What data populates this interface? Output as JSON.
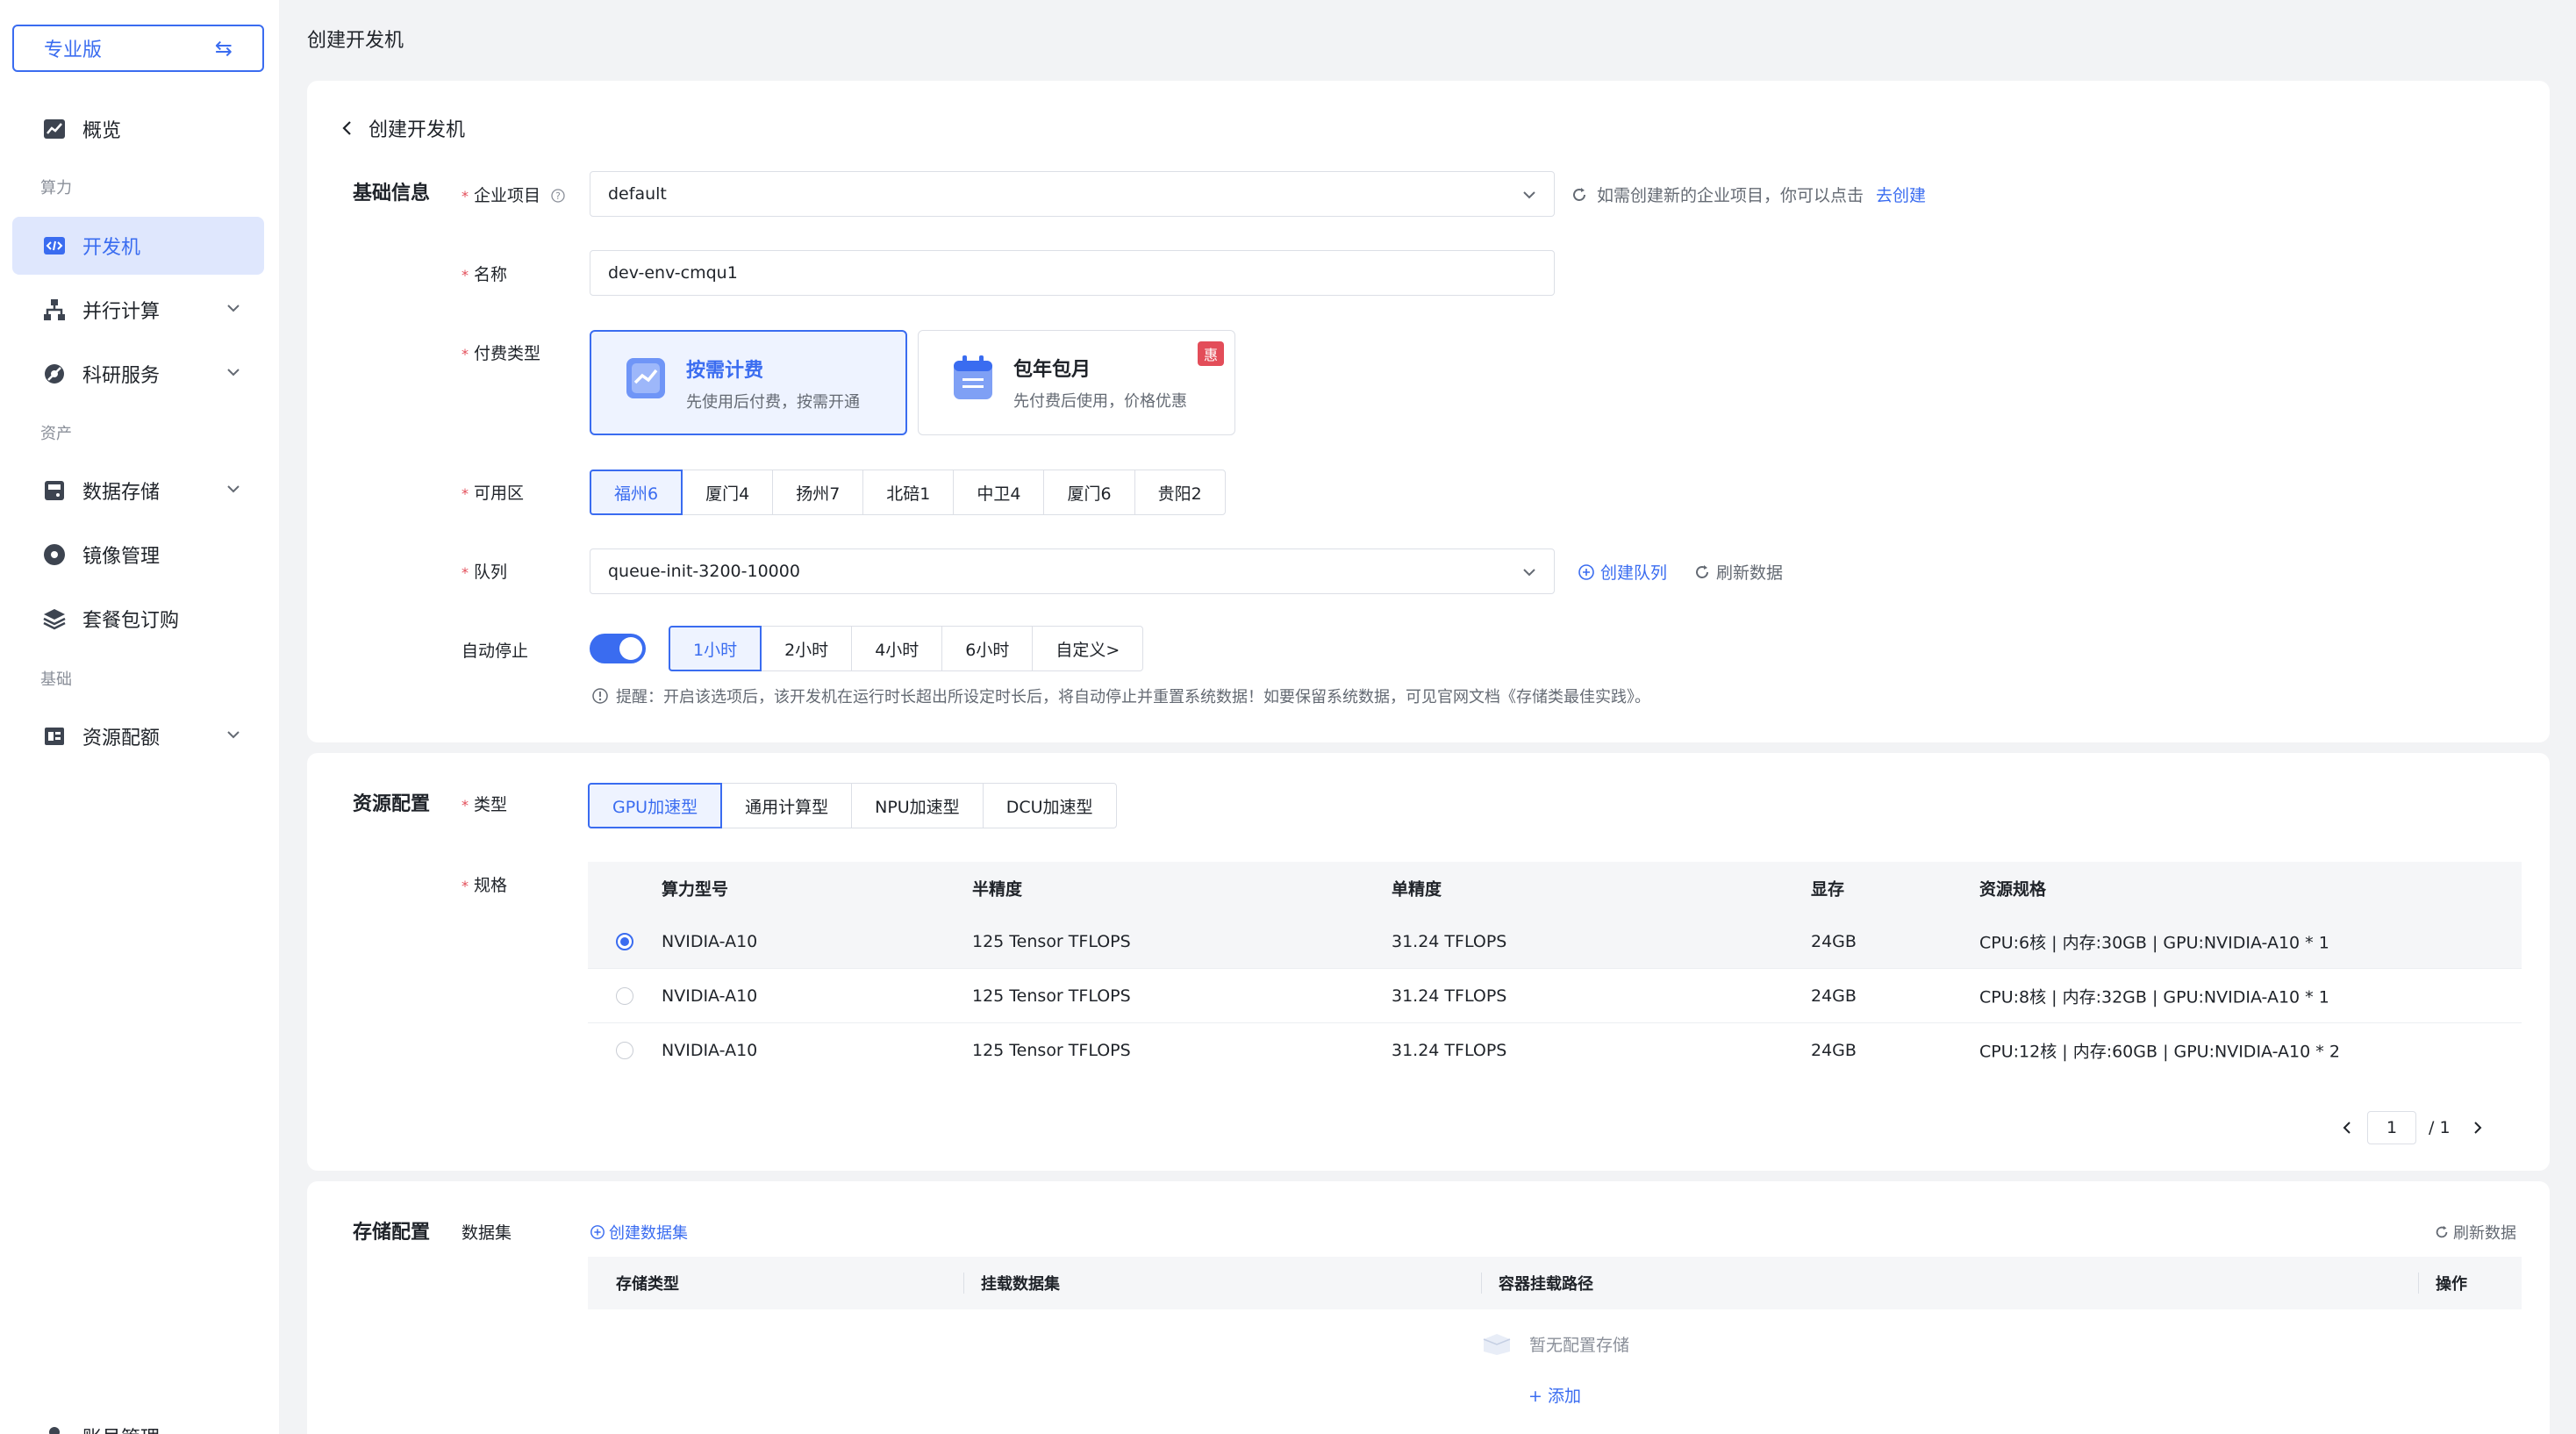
{
  "sidebar": {
    "edition_label": "专业版",
    "items": {
      "overview": "概览",
      "dev_machine": "开发机",
      "parallel": "并行计算",
      "research": "科研服务",
      "storage": "数据存储",
      "image": "镜像管理",
      "package": "套餐包订购",
      "quota": "资源配额",
      "account": "账号管理"
    },
    "groups": {
      "compute": "算力",
      "assets": "资产",
      "basic": "基础"
    }
  },
  "page": {
    "top_title": "创建开发机",
    "back_title": "创建开发机"
  },
  "basic": {
    "section_title": "基础信息",
    "project_label": "企业项目",
    "project_value": "default",
    "project_hint": "如需创建新的企业项目，你可以点击",
    "project_link": "去创建",
    "name_label": "名称",
    "name_value": "dev-env-cmqu1",
    "pay_label": "付费类型",
    "pay_options": [
      {
        "title": "按需计费",
        "sub": "先使用后付费，按需开通"
      },
      {
        "title": "包年包月",
        "sub": "先付费后使用，价格优惠",
        "badge": "惠"
      }
    ],
    "zone_label": "可用区",
    "zones": [
      "福州6",
      "厦门4",
      "扬州7",
      "北碚1",
      "中卫4",
      "厦门6",
      "贵阳2"
    ],
    "queue_label": "队列",
    "queue_value": "queue-init-3200-10000",
    "create_queue": "创建队列",
    "refresh": "刷新数据",
    "autostop_label": "自动停止",
    "autostop_options": [
      "1小时",
      "2小时",
      "4小时",
      "6小时",
      "自定义>"
    ],
    "autostop_tip": "提醒：开启该选项后，该开发机在运行时长超出所设定时长后，将自动停止并重置系统数据！如要保留系统数据，可见官网文档《存储类最佳实践》。"
  },
  "resource": {
    "section_title": "资源配置",
    "type_label": "类型",
    "types": [
      "GPU加速型",
      "通用计算型",
      "NPU加速型",
      "DCU加速型"
    ],
    "spec_label": "规格",
    "columns": [
      "算力型号",
      "半精度",
      "单精度",
      "显存",
      "资源规格"
    ],
    "rows": [
      [
        "NVIDIA-A10",
        "125 Tensor TFLOPS",
        "31.24 TFLOPS",
        "24GB",
        "CPU:6核 | 内存:30GB | GPU:NVIDIA-A10 * 1"
      ],
      [
        "NVIDIA-A10",
        "125 Tensor TFLOPS",
        "31.24 TFLOPS",
        "24GB",
        "CPU:8核 | 内存:32GB | GPU:NVIDIA-A10 * 1"
      ],
      [
        "NVIDIA-A10",
        "125 Tensor TFLOPS",
        "31.24 TFLOPS",
        "24GB",
        "CPU:12核 | 内存:60GB | GPU:NVIDIA-A10 * 2"
      ]
    ],
    "pager_current": "1",
    "pager_total": "/ 1"
  },
  "storage": {
    "section_title": "存储配置",
    "dataset_label": "数据集",
    "create_dataset": "创建数据集",
    "refresh": "刷新数据",
    "columns": [
      "存储类型",
      "挂载数据集",
      "容器挂载路径",
      "操作"
    ],
    "empty_text": "暂无配置存储",
    "add_label": "+ 添加"
  },
  "colors": {
    "primary": "#3a6cf0",
    "danger": "#e34d59"
  }
}
